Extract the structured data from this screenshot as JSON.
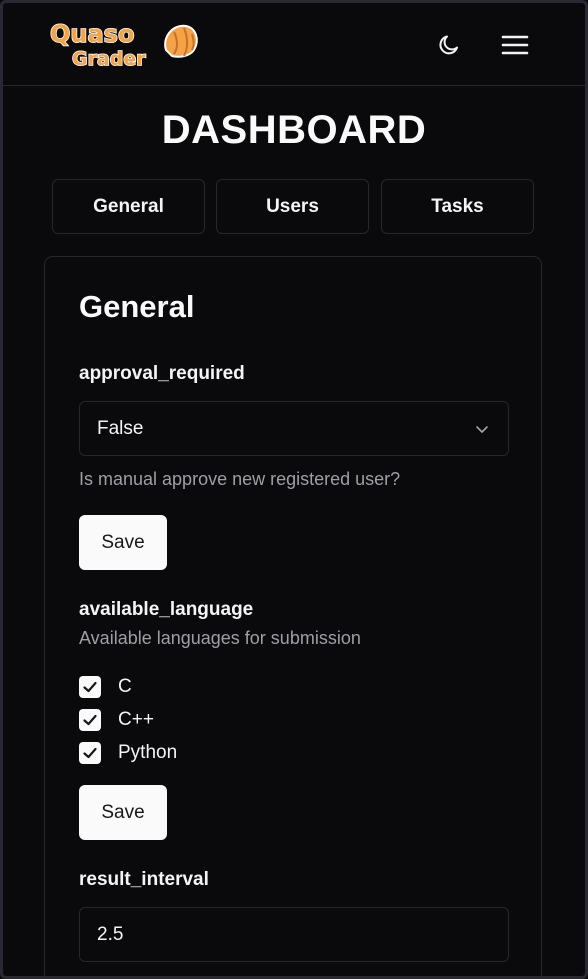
{
  "header": {
    "logo_line1": "Quaso",
    "logo_line2": "Grader",
    "theme_icon": "moon-icon",
    "menu_icon": "hamburger-menu-icon"
  },
  "page_title": "DASHBOARD",
  "tabs": [
    {
      "label": "General"
    },
    {
      "label": "Users"
    },
    {
      "label": "Tasks"
    }
  ],
  "card": {
    "title": "General",
    "approval_required": {
      "label": "approval_required",
      "value": "False",
      "help": "Is manual approve new registered user?",
      "save_label": "Save"
    },
    "available_language": {
      "label": "available_language",
      "help": "Available languages for submission",
      "options": [
        {
          "label": "C",
          "checked": true
        },
        {
          "label": "C++",
          "checked": true
        },
        {
          "label": "Python",
          "checked": true
        }
      ],
      "save_label": "Save"
    },
    "result_interval": {
      "label": "result_interval",
      "value": "2.5"
    }
  },
  "colors": {
    "background": "#0a0a0c",
    "border": "#27272a",
    "logo_orange": "#f5a347",
    "button_bg": "#fafafa"
  }
}
